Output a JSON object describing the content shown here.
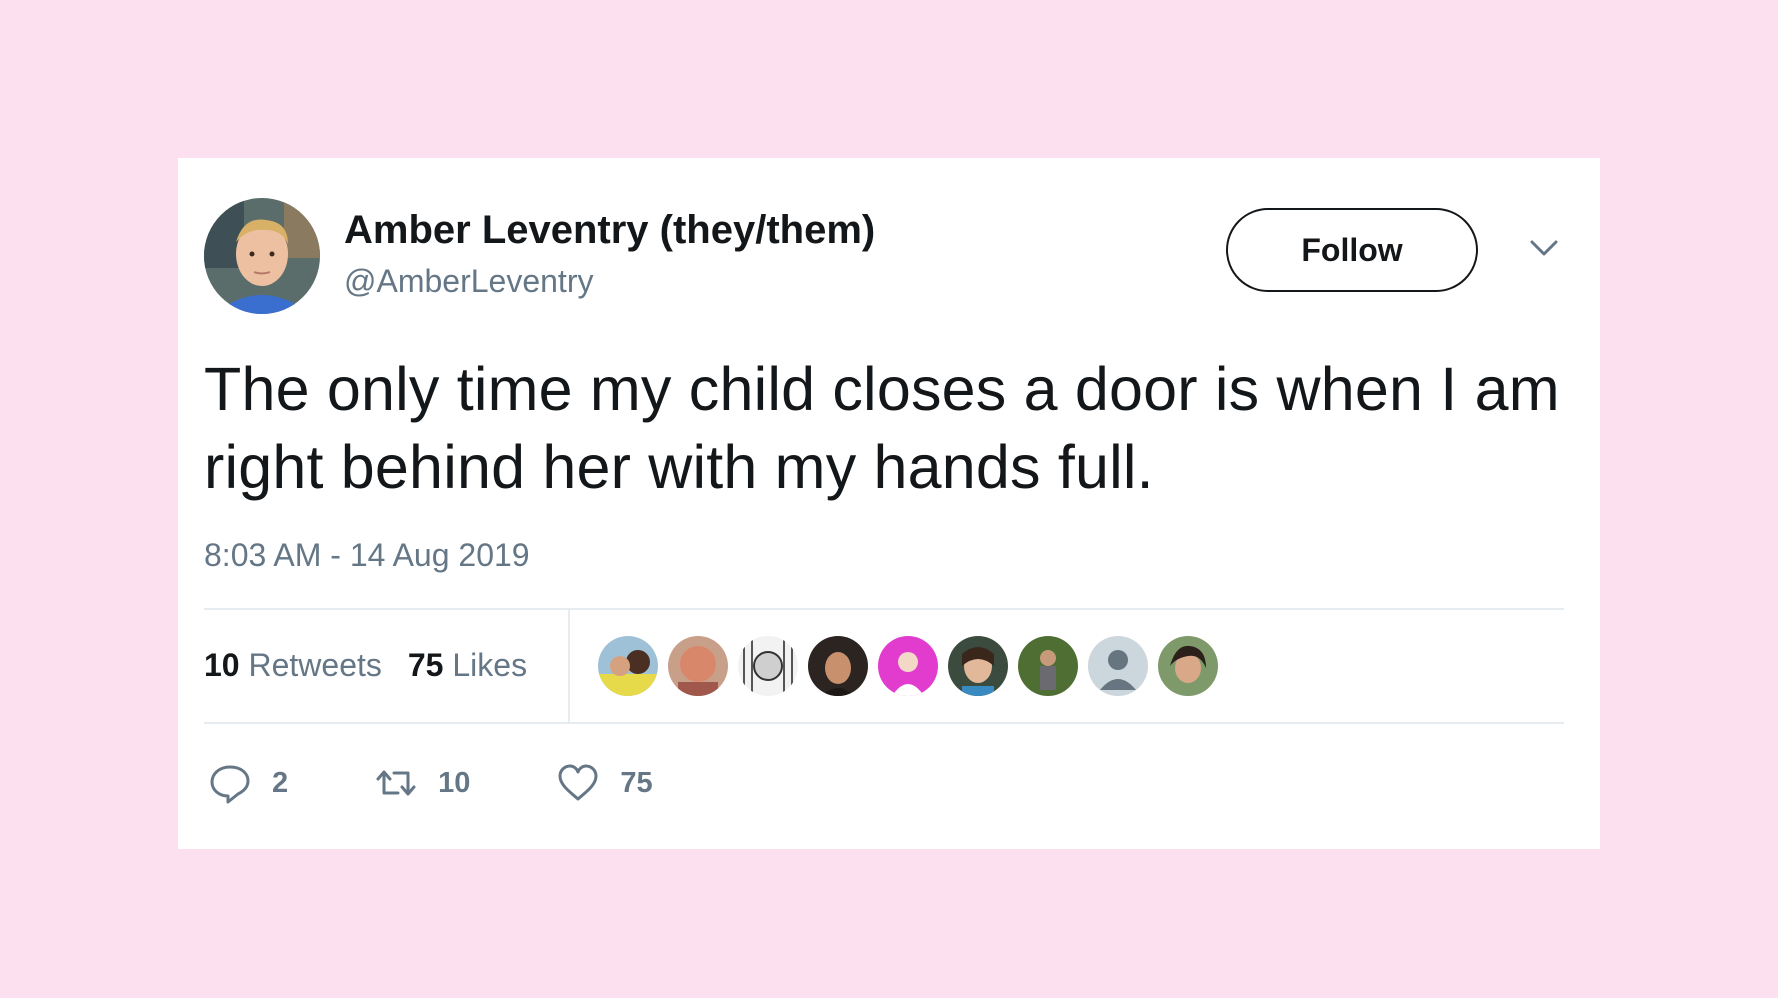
{
  "tweet": {
    "author_name": "Amber Leventry (they/them)",
    "author_handle": "@AmberLeventry",
    "follow_label": "Follow",
    "text": "The only time my child closes a door is when I am right behind her with my hands full.",
    "timestamp": "8:03 AM - 14 Aug 2019"
  },
  "stats": {
    "retweets_count": "10",
    "retweets_label": "Retweets",
    "likes_count": "75",
    "likes_label": "Likes"
  },
  "actions": {
    "reply_count": "2",
    "retweet_count": "10",
    "like_count": "75"
  },
  "icons": {
    "reply": "speech-bubble-icon",
    "retweet": "retweet-arrows-icon",
    "like": "heart-icon",
    "menu": "chevron-down-icon"
  },
  "colors": {
    "background": "#fde0ef",
    "card": "#ffffff",
    "text_primary": "#14171a",
    "text_secondary": "#657786",
    "divider": "#e6ecf0"
  }
}
